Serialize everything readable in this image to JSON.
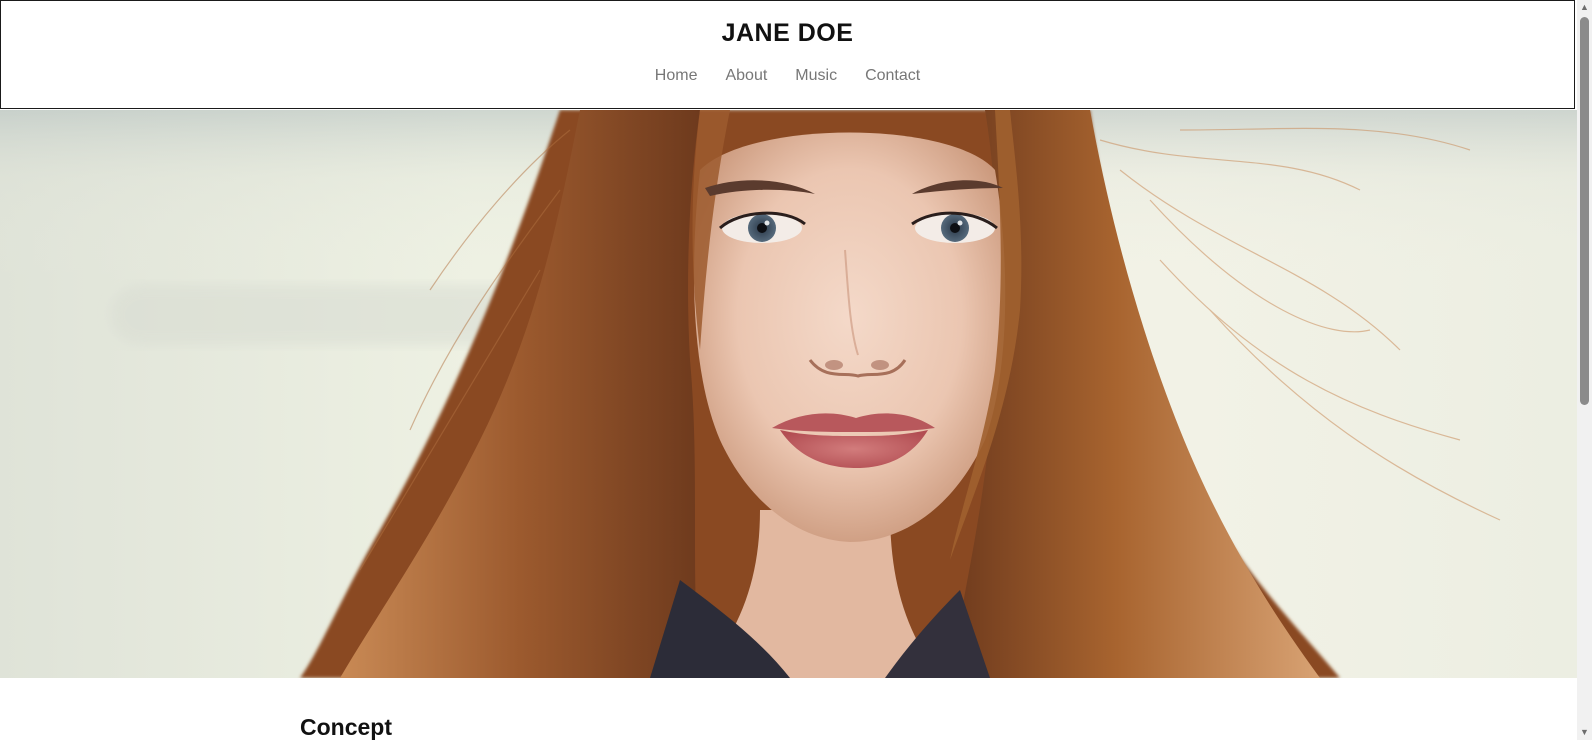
{
  "site": {
    "title": "JANE DOE"
  },
  "nav": {
    "items": [
      {
        "label": "Home"
      },
      {
        "label": "About"
      },
      {
        "label": "Music"
      },
      {
        "label": "Contact"
      }
    ]
  },
  "hero": {
    "icon": "portrait-photo"
  },
  "section": {
    "heading": "Concept"
  },
  "scrollbar": {
    "up_icon": "arrow-up-icon",
    "down_icon": "arrow-down-icon",
    "up_glyph": "▲",
    "down_glyph": "▼"
  },
  "colors": {
    "heading": "#111111",
    "nav_link": "#777777",
    "hair": "#b56a36",
    "background": "#eef0e4"
  }
}
